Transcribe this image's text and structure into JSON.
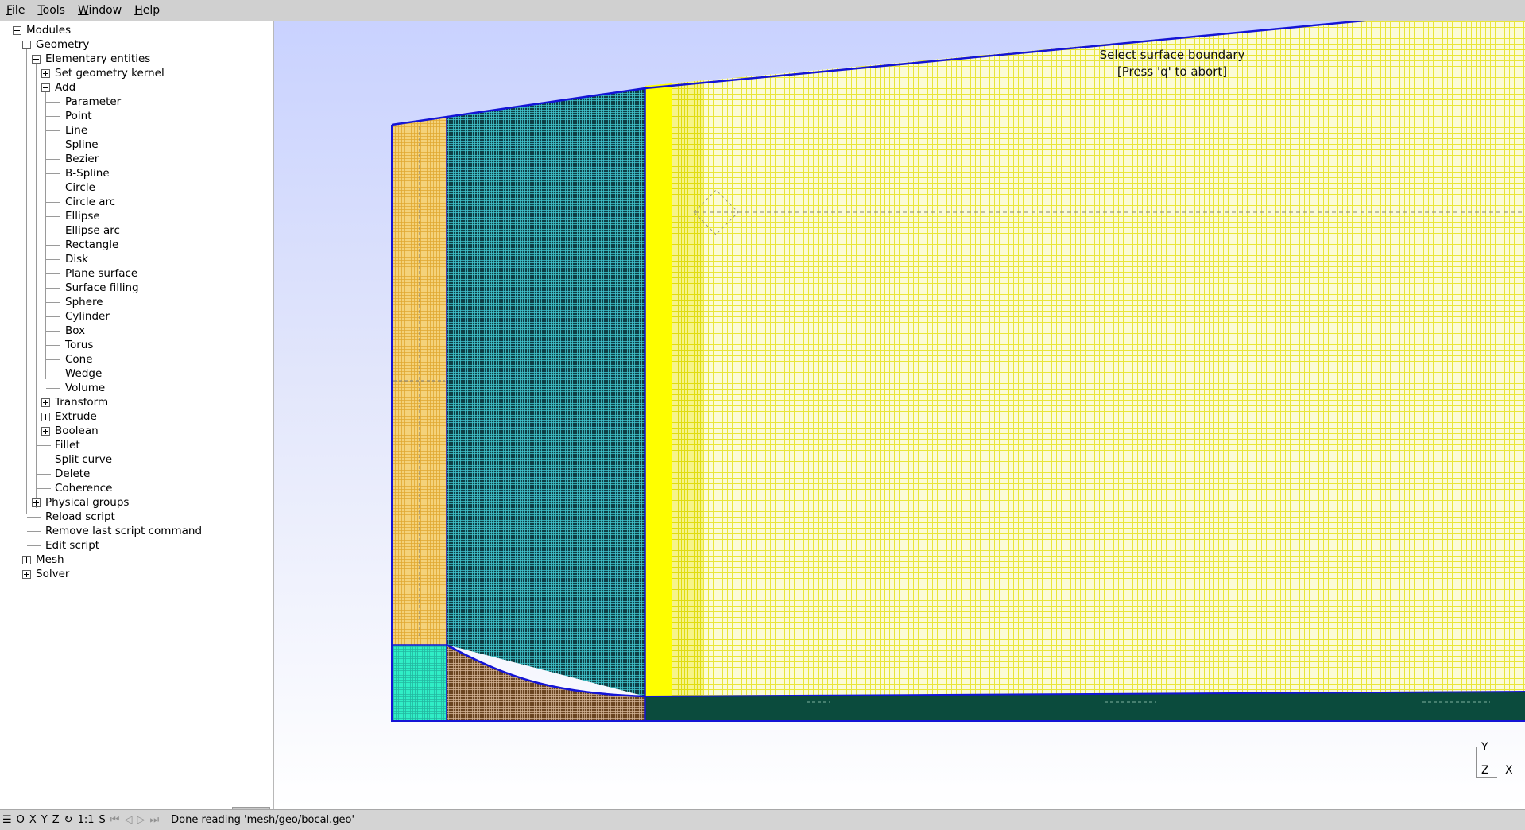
{
  "menubar": {
    "items": [
      {
        "label": "File",
        "ul": "F",
        "rest": "ile"
      },
      {
        "label": "Tools",
        "ul": "T",
        "rest": "ools"
      },
      {
        "label": "Window",
        "ul": "W",
        "rest": "indow"
      },
      {
        "label": "Help",
        "ul": "H",
        "rest": "elp"
      }
    ]
  },
  "tree": {
    "modules": "Modules",
    "geometry": "Geometry",
    "elementary": "Elementary entities",
    "set_kernel": "Set geometry kernel",
    "add": "Add",
    "add_items": [
      "Parameter",
      "Point",
      "Line",
      "Spline",
      "Bezier",
      "B-Spline",
      "Circle",
      "Circle arc",
      "Ellipse",
      "Ellipse arc",
      "Rectangle",
      "Disk",
      "Plane surface",
      "Surface filling",
      "Sphere",
      "Cylinder",
      "Box",
      "Torus",
      "Cone",
      "Wedge",
      "Volume"
    ],
    "transform": "Transform",
    "extrude": "Extrude",
    "boolean": "Boolean",
    "fillet": "Fillet",
    "split_curve": "Split curve",
    "delete": "Delete",
    "coherence": "Coherence",
    "physical_groups": "Physical groups",
    "reload_script": "Reload script",
    "remove_last": "Remove last script command",
    "edit_script": "Edit script",
    "mesh": "Mesh",
    "solver": "Solver"
  },
  "graphics": {
    "hint_line1": "Select surface boundary",
    "hint_line2": "[Press 'q' to abort]",
    "axis_y": "Y",
    "axis_z": "Z",
    "axis_x": "X",
    "colors": {
      "yellow_mesh": "#ffff00",
      "teal_mesh": "#0d4b4b",
      "cyan_mesh": "#2ef0c8",
      "brown_mesh": "#5a3a12",
      "orange_mesh": "#f0c060",
      "dark_green": "#0a4a3c",
      "boundary": "#1010d0"
    }
  },
  "statusbar": {
    "buttons": [
      "O",
      "X",
      "Y",
      "Z",
      "1:1",
      "S"
    ],
    "message": "Done reading 'mesh/geo/bocal.geo'"
  }
}
